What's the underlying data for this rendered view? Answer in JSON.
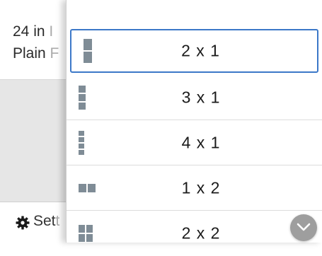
{
  "background_info": {
    "line1_visible": "24 in",
    "line1_faded": "I",
    "line2_visible": "Plain",
    "line2_faded": "F",
    "settings_visible": "Set",
    "settings_faded": "t"
  },
  "dropdown": {
    "options": [
      {
        "label": "2 x 1",
        "icon": "layout-2x1-icon",
        "selected": true
      },
      {
        "label": "3 x 1",
        "icon": "layout-3x1-icon",
        "selected": false
      },
      {
        "label": "4 x 1",
        "icon": "layout-4x1-icon",
        "selected": false
      },
      {
        "label": "1 x 2",
        "icon": "layout-1x2-icon",
        "selected": false
      },
      {
        "label": "2 x 2",
        "icon": "layout-2x2-icon",
        "selected": false
      }
    ]
  },
  "colors": {
    "selection_border": "#3c78c8",
    "icon_fill": "#7f8c96",
    "scroll_button": "#9e9e9e"
  }
}
